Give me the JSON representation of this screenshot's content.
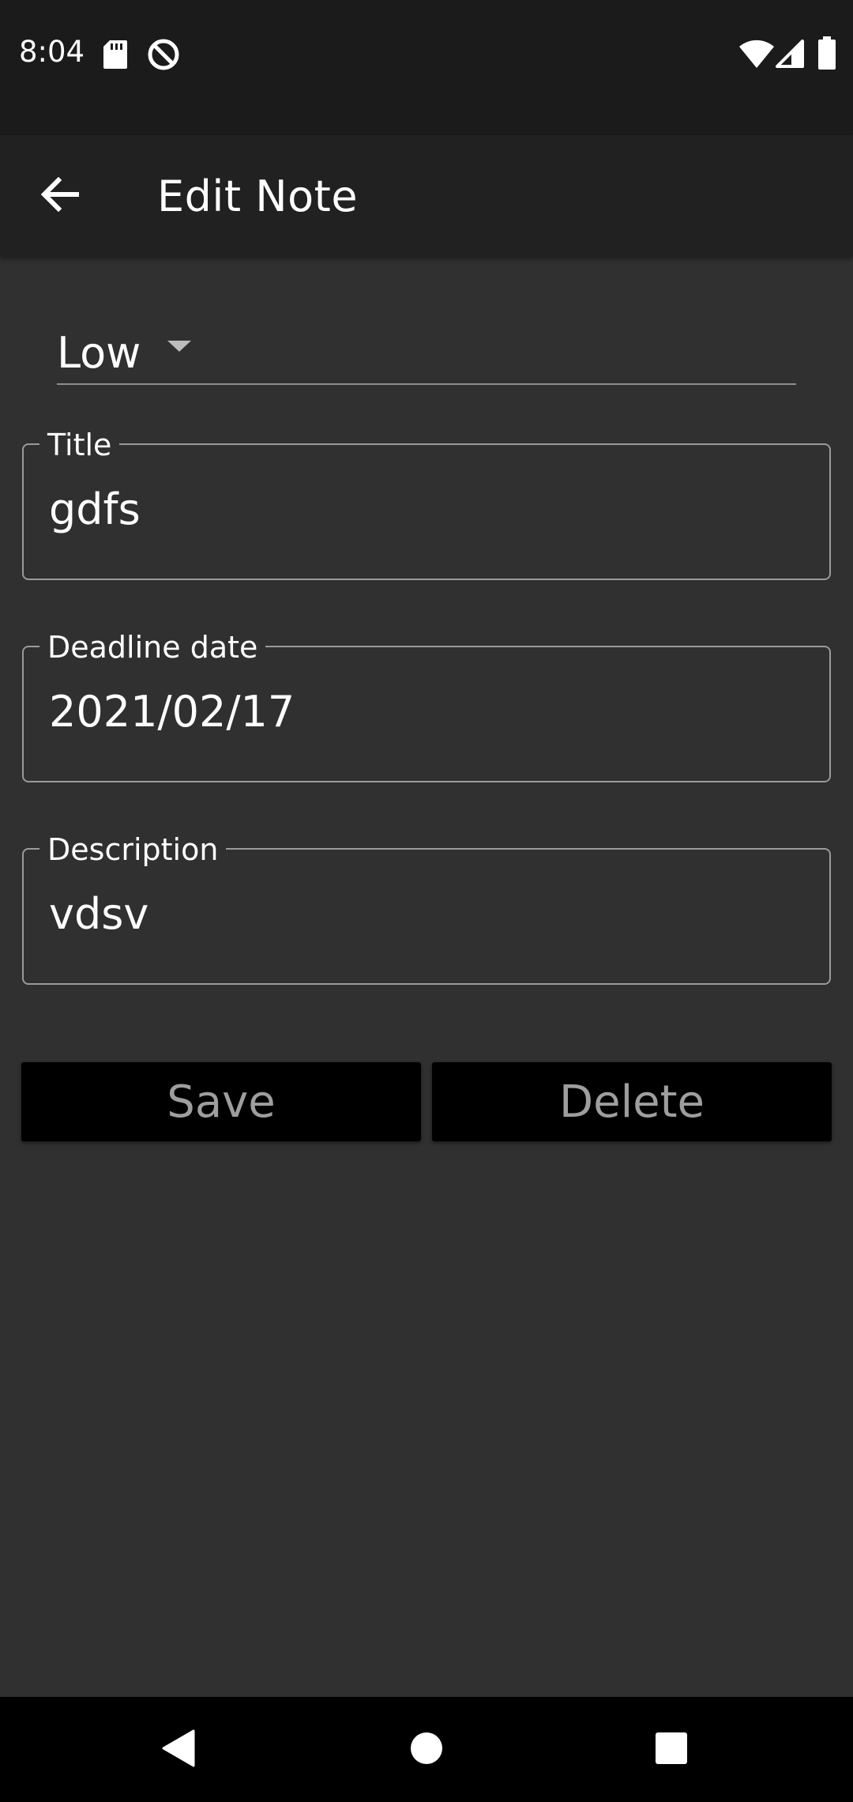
{
  "status_bar": {
    "time": "8:04",
    "left_icons": [
      "sd-card-icon",
      "do-not-disturb-icon"
    ],
    "right_icons": [
      "wifi-icon",
      "cell-signal-icon",
      "battery-icon"
    ]
  },
  "app_bar": {
    "back_icon": "arrow-left-icon",
    "title": "Edit Note"
  },
  "form": {
    "priority": {
      "selected": "Low"
    },
    "title": {
      "label": "Title",
      "value": "gdfs"
    },
    "deadline": {
      "label": "Deadline date",
      "value": "2021/02/17"
    },
    "description": {
      "label": "Description",
      "value": "vdsv"
    }
  },
  "actions": {
    "save_label": "Save",
    "delete_label": "Delete"
  },
  "nav_bar": {
    "icons": [
      "back-triangle-icon",
      "home-circle-icon",
      "recents-square-icon"
    ]
  },
  "colors": {
    "background": "#303030",
    "app_bar": "#212121",
    "status_bar": "#1b1b1b",
    "button_bg": "#000000",
    "button_text": "#9e9e9e",
    "outline": "#9a9a9a"
  }
}
